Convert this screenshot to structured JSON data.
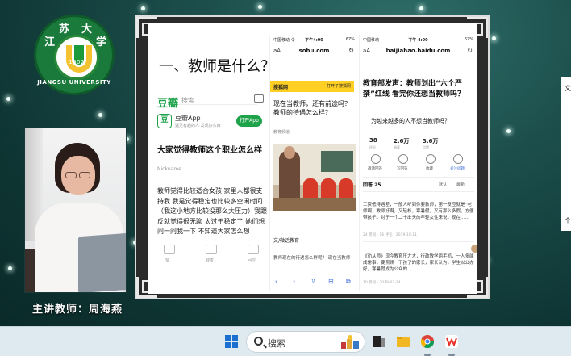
{
  "logo": {
    "chars": [
      "江",
      "苏",
      "大",
      "学"
    ],
    "year": "1902",
    "english": "JIANGSU UNIVERSITY"
  },
  "teacher_label": "主讲教师：周海燕",
  "slide": {
    "title": "一、教师是什么？",
    "douban": {
      "logo": "豆瓣",
      "search_placeholder": "搜索",
      "app_icon": "豆",
      "app_name": "豆瓣App",
      "app_sub": "遇见有趣的人·发现好东西",
      "open_button": "打开App",
      "headline": "大家觉得教师这个职业怎么样",
      "author": "Nickname",
      "body": "教师觉得比较适合女孩 家里人都很支持我 我是觉得稳定也比较多空闲时间（我这小地方比较没那么大压力）我跟反就觉得很无聊 太过于稳定了 她们想问一问我一下 不知道大家怎么想",
      "footer": [
        "赞",
        "转发",
        "回应"
      ]
    },
    "sohu": {
      "carrier": "中国移动 令",
      "time": "下午4:00",
      "battery": "67%",
      "aa": "aA",
      "url": "sohu.com",
      "reload": "↻",
      "brand": "搜狐网",
      "badge": "打开了搜狐网",
      "question": "现在当教师，还有前途吗？教师的待遇怎么样？",
      "author": "教育频道",
      "sub_title": "文/微话教育",
      "line": "教师现在的待遇怎么样呢？ 现在当教师",
      "nav": [
        "‹",
        "›",
        "⇪",
        "⊞",
        "⧉"
      ]
    },
    "baijiahao": {
      "carrier": "中国移动",
      "time": "下午 4:00",
      "battery": "67%",
      "aa": "aA",
      "url": "baijiahao.baidu.com",
      "reload": "↻",
      "headline": "教育部发声：教师划出“六个严禁”红线 看完你还想当教师吗？",
      "subtitle": "为越来越多的人不想当教师吗？",
      "stats": [
        {
          "value": "38",
          "label": "评论"
        },
        {
          "value": "2.6万",
          "label": "阅读"
        },
        {
          "value": "3.6万",
          "label": "点赞"
        }
      ],
      "actions": [
        "邀请回答",
        "写回答",
        "收藏",
        "关注问题"
      ],
      "reply_label": "回答 25",
      "sort": [
        "默认",
        "最新"
      ],
      "notes": [
        "工资低待遇差，一般人听到你要教师，第一反应就是“老师啊，教师好啊，又轻松，寒暑假，又有那么多假，方便带孩子。对于一个二十出头的年轻女性来说，现在……",
        "《劝从师》现今教育压力大，行政教学两手抓，一人多能成常事，要照顾一下孩子的家长，家长认为，学生以公办好，寒暑假成为公众的……"
      ],
      "metas": [
        "24 赞同 · 16 评论 · 2019-10-11",
        "10 赞同 · 2019-07-24"
      ]
    }
  },
  "side_labels": [
    "文",
    "个"
  ],
  "taskbar": {
    "search_text": "搜索",
    "apps": [
      "task-view",
      "file-explorer",
      "chrome",
      "wps-office"
    ]
  },
  "colors": {
    "douban_green": "#1ea34a",
    "sohu_yellow": "#ffcf24",
    "accent_blue": "#1a6fd0"
  }
}
